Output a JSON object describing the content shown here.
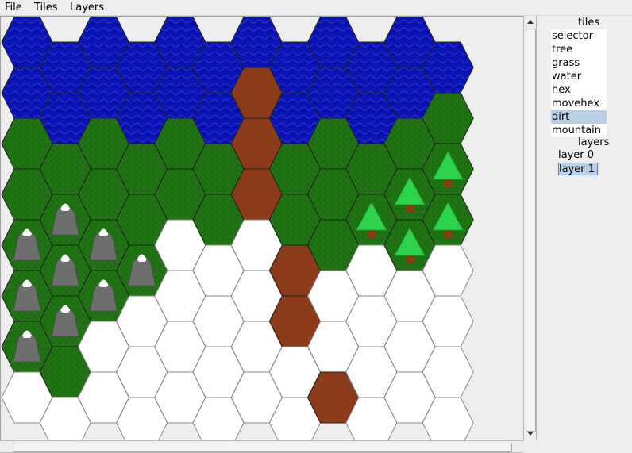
{
  "menubar": {
    "file": "File",
    "tiles": "Tiles",
    "layers": "Layers"
  },
  "sidebar": {
    "tiles_title": "tiles",
    "tiles": [
      {
        "label": "selector",
        "selected": false
      },
      {
        "label": "tree",
        "selected": false
      },
      {
        "label": "grass",
        "selected": false
      },
      {
        "label": "water",
        "selected": false
      },
      {
        "label": "hex",
        "selected": false
      },
      {
        "label": "movehex",
        "selected": false
      },
      {
        "label": "dirt",
        "selected": true
      },
      {
        "label": "mountain",
        "selected": false
      }
    ],
    "layers_title": "layers",
    "layers": [
      {
        "label": "layer 0",
        "selected": false
      },
      {
        "label": "layer 1",
        "selected": true
      }
    ]
  },
  "map": {
    "colors": {
      "water": "#0a14b4",
      "grass": "#1e6e12",
      "dirt": "#8c3c1a",
      "empty": "#ffffff",
      "tree": "#2cd24a",
      "trunk": "#8c3c12",
      "mountain": "#6e6e6e",
      "snow": "#ffffff"
    },
    "columns": [
      [
        "water",
        "water",
        "grass",
        "grass",
        "grass",
        "grass",
        "grass",
        "empty"
      ],
      [
        "water",
        "water",
        "grass",
        "grass",
        "grass",
        "grass",
        "grass",
        "empty"
      ],
      [
        "water",
        "water",
        "grass",
        "grass",
        "grass",
        "grass",
        "empty",
        "empty"
      ],
      [
        "water",
        "water",
        "grass",
        "grass",
        "grass",
        "empty",
        "empty",
        "empty"
      ],
      [
        "water",
        "water",
        "grass",
        "grass",
        "empty",
        "empty",
        "empty",
        "empty"
      ],
      [
        "water",
        "water",
        "grass",
        "grass",
        "empty",
        "empty",
        "empty",
        "empty"
      ],
      [
        "water",
        "dirt",
        "dirt",
        "dirt",
        "empty",
        "empty",
        "empty",
        "empty"
      ],
      [
        "water",
        "water",
        "grass",
        "grass",
        "dirt",
        "dirt",
        "empty",
        "empty"
      ],
      [
        "water",
        "water",
        "grass",
        "grass",
        "grass",
        "empty",
        "empty",
        "dirt"
      ],
      [
        "water",
        "water",
        "grass",
        "grass",
        "empty",
        "empty",
        "empty",
        "empty"
      ],
      [
        "water",
        "water",
        "grass",
        "grass",
        "grass",
        "empty",
        "empty",
        "empty"
      ],
      [
        "water",
        "grass",
        "grass",
        "grass",
        "empty",
        "empty",
        "empty",
        "empty"
      ]
    ],
    "objects": [
      {
        "col": 0,
        "row": 4,
        "type": "mountain"
      },
      {
        "col": 0,
        "row": 5,
        "type": "mountain"
      },
      {
        "col": 0,
        "row": 6,
        "type": "mountain"
      },
      {
        "col": 1,
        "row": 3,
        "type": "mountain"
      },
      {
        "col": 1,
        "row": 4,
        "type": "mountain"
      },
      {
        "col": 1,
        "row": 5,
        "type": "mountain"
      },
      {
        "col": 2,
        "row": 4,
        "type": "mountain"
      },
      {
        "col": 2,
        "row": 5,
        "type": "mountain"
      },
      {
        "col": 3,
        "row": 4,
        "type": "mountain"
      },
      {
        "col": 9,
        "row": 3,
        "type": "tree"
      },
      {
        "col": 10,
        "row": 3,
        "type": "tree"
      },
      {
        "col": 10,
        "row": 4,
        "type": "tree"
      },
      {
        "col": 11,
        "row": 2,
        "type": "tree"
      },
      {
        "col": 11,
        "row": 3,
        "type": "tree"
      }
    ]
  }
}
